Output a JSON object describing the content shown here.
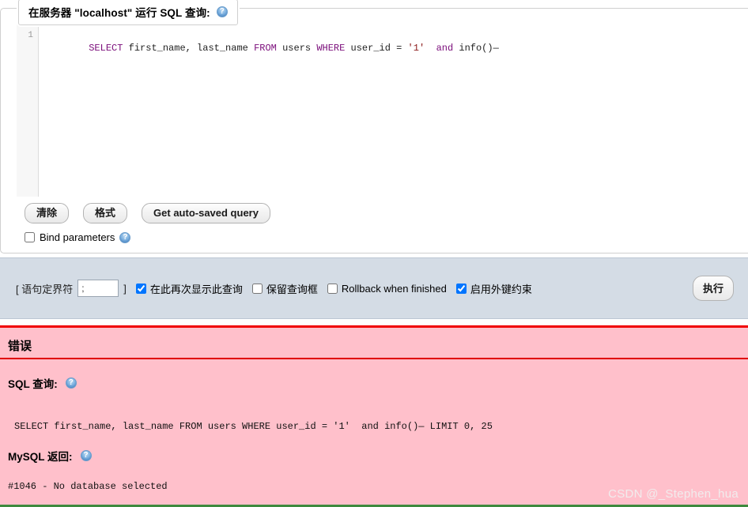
{
  "sql_panel": {
    "legend_title": "在服务器 \"localhost\" 运行 SQL 查询:",
    "legend_help_icon": "help-icon",
    "editor": {
      "line_number": "1",
      "query_tokens": [
        {
          "t": "SELECT",
          "c": "kw"
        },
        {
          "t": " first_name, last_name ",
          "c": "plain"
        },
        {
          "t": "FROM",
          "c": "kw"
        },
        {
          "t": " users ",
          "c": "plain"
        },
        {
          "t": "WHERE",
          "c": "kw"
        },
        {
          "t": " user_id = ",
          "c": "plain"
        },
        {
          "t": "'1'",
          "c": "str"
        },
        {
          "t": "  ",
          "c": "plain"
        },
        {
          "t": "and",
          "c": "kw"
        },
        {
          "t": " info()—",
          "c": "plain"
        }
      ],
      "query_text": "SELECT first_name, last_name FROM users WHERE user_id = '1'  and info()—"
    },
    "buttons": {
      "clear": "清除",
      "format": "格式",
      "get_auto_saved": "Get auto-saved query"
    },
    "bind_parameters": {
      "label": "Bind parameters",
      "checked": false,
      "help_icon": "help-icon"
    }
  },
  "options_bar": {
    "delimiter_open_bracket": "[ 语句定界符",
    "delimiter_value": ";",
    "delimiter_close_bracket": "]",
    "checkboxes": [
      {
        "label": "在此再次显示此查询",
        "checked": true
      },
      {
        "label": "保留查询框",
        "checked": false
      },
      {
        "label": "Rollback when finished",
        "checked": false
      },
      {
        "label": "启用外键约束",
        "checked": true
      }
    ],
    "go_button": "执行"
  },
  "error_panel": {
    "title": "错误",
    "sql_query_label": "SQL 查询:",
    "sql_query_help_icon": "help-icon",
    "sql_query_text": "SELECT first_name, last_name FROM users WHERE user_id = '1'  and info()— LIMIT 0, 25",
    "mysql_return_label": "MySQL 返回:",
    "mysql_return_help_icon": "help-icon",
    "mysql_error_text": "#1046 - No database selected",
    "background_color": "#ffc0cb",
    "accent_color": "#f00000"
  },
  "watermark": "CSDN @_Stephen_hua"
}
